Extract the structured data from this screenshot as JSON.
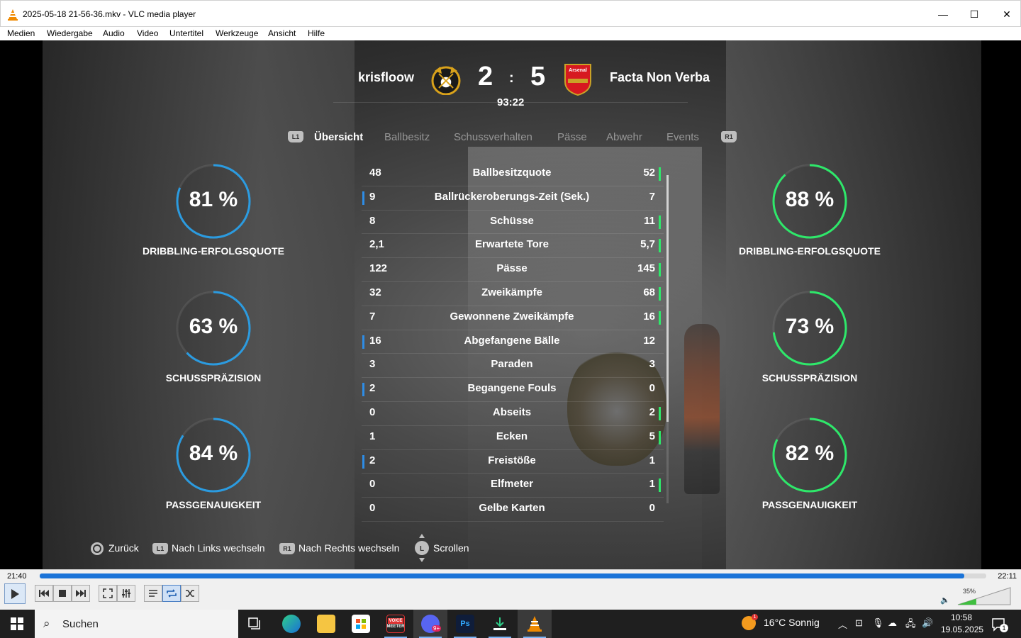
{
  "window": {
    "title": "2025-05-18 21-56-36.mkv - VLC media player",
    "minimize": "—",
    "maximize": "☐",
    "close": "✕"
  },
  "menu": [
    "Medien",
    "Wiedergabe",
    "Audio",
    "Video",
    "Untertitel",
    "Werkzeuge",
    "Ansicht",
    "Hilfe"
  ],
  "match": {
    "home_team": "krisfloow",
    "away_team": "Facta Non Verba",
    "home_goals": "2",
    "away_goals": "5",
    "separator": ":",
    "clock": "93:22",
    "away_crest_text": "Arsenal"
  },
  "tabs": {
    "left_button": "L1",
    "right_button": "R1",
    "items": [
      "Übersicht",
      "Ballbesitz",
      "Schussverhalten",
      "Pässe",
      "Abwehr",
      "Events"
    ],
    "active": "Übersicht"
  },
  "stats": [
    {
      "home": "48",
      "label": "Ballbesitzquote",
      "away": "52",
      "lead": "away"
    },
    {
      "home": "9",
      "label": "Ballrückeroberungs-Zeit (Sek.)",
      "away": "7",
      "lead": "home"
    },
    {
      "home": "8",
      "label": "Schüsse",
      "away": "11",
      "lead": "away"
    },
    {
      "home": "2,1",
      "label": "Erwartete Tore",
      "away": "5,7",
      "lead": "away"
    },
    {
      "home": "122",
      "label": "Pässe",
      "away": "145",
      "lead": "away"
    },
    {
      "home": "32",
      "label": "Zweikämpfe",
      "away": "68",
      "lead": "away"
    },
    {
      "home": "7",
      "label": "Gewonnene Zweikämpfe",
      "away": "16",
      "lead": "away"
    },
    {
      "home": "16",
      "label": "Abgefangene Bälle",
      "away": "12",
      "lead": "home"
    },
    {
      "home": "3",
      "label": "Paraden",
      "away": "3",
      "lead": "none"
    },
    {
      "home": "2",
      "label": "Begangene Fouls",
      "away": "0",
      "lead": "home"
    },
    {
      "home": "0",
      "label": "Abseits",
      "away": "2",
      "lead": "away"
    },
    {
      "home": "1",
      "label": "Ecken",
      "away": "5",
      "lead": "away"
    },
    {
      "home": "2",
      "label": "Freistöße",
      "away": "1",
      "lead": "home"
    },
    {
      "home": "0",
      "label": "Elfmeter",
      "away": "1",
      "lead": "away"
    },
    {
      "home": "0",
      "label": "Gelbe Karten",
      "away": "0",
      "lead": "none"
    }
  ],
  "gauges": {
    "home_color": "#2b9be0",
    "away_color": "#2ee86a",
    "home": [
      {
        "value": "81 %",
        "fraction": 0.81,
        "label": "DRIBBLING-ERFOLGSQUOTE"
      },
      {
        "value": "63 %",
        "fraction": 0.63,
        "label": "SCHUSSPRÄZISION"
      },
      {
        "value": "84 %",
        "fraction": 0.84,
        "label": "PASSGENAUIGKEIT"
      }
    ],
    "away": [
      {
        "value": "88 %",
        "fraction": 0.88,
        "label": "DRIBBLING-ERFOLGSQUOTE"
      },
      {
        "value": "73 %",
        "fraction": 0.73,
        "label": "SCHUSSPRÄZISION"
      },
      {
        "value": "82 %",
        "fraction": 0.82,
        "label": "PASSGENAUIGKEIT"
      }
    ]
  },
  "hints": {
    "back": "Zurück",
    "prev": "Nach Links wechseln",
    "next": "Nach Rechts wechseln",
    "scroll": "Scrollen",
    "l1": "L1",
    "r1": "R1",
    "stick": "L"
  },
  "player": {
    "elapsed": "21:40",
    "total": "22:11",
    "progress": 0.977,
    "volume": "35%",
    "volume_fraction": 0.35
  },
  "taskbar": {
    "search_placeholder": "Suchen",
    "weather": "16°C  Sonnig",
    "time": "10:58",
    "date": "19.05.2025",
    "notification_count": "1",
    "weather_badge": "1",
    "voicemeeter_label_top": "VOICE",
    "voicemeeter_label_bottom": "MEETER",
    "discord_badge": "9+",
    "photoshop_label": "Ps"
  }
}
